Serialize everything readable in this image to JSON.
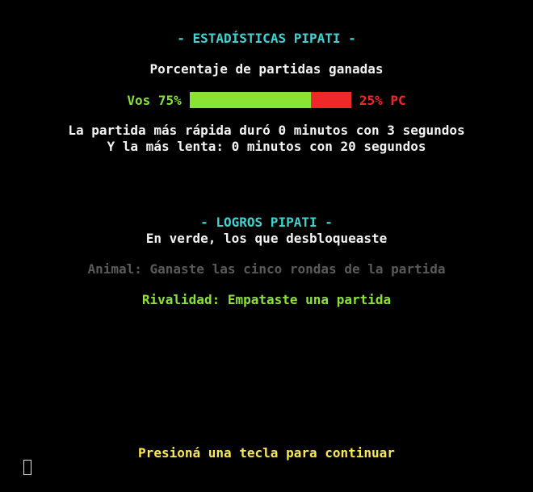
{
  "stats": {
    "title": "- ESTADÍSTICAS PIPATI -",
    "subtitle": "Porcentaje de partidas ganadas",
    "player_label": "Vos 75%",
    "pc_label": "25% PC",
    "player_win_percent": 75,
    "pc_win_percent": 25,
    "fastest_line": "La partida más rápida duró 0 minutos con 3 segundos",
    "slowest_line": "Y la más lenta: 0 minutos con 20 segundos"
  },
  "achievements": {
    "title": "- LOGROS PIPATI -",
    "subtitle": "En verde, los que desbloqueaste",
    "items": [
      {
        "text": "Animal: Ganaste las cinco rondas de la partida",
        "unlocked": false
      },
      {
        "text": "Rivalidad: Empataste una partida",
        "unlocked": true
      }
    ]
  },
  "footer": {
    "prompt": "Presioná una tecla para continuar"
  },
  "colors": {
    "title": "#3fd3d3",
    "unlocked": "#8ae234",
    "locked": "#5a5a5a",
    "loss": "#ef2929",
    "prompt": "#fce94f"
  }
}
